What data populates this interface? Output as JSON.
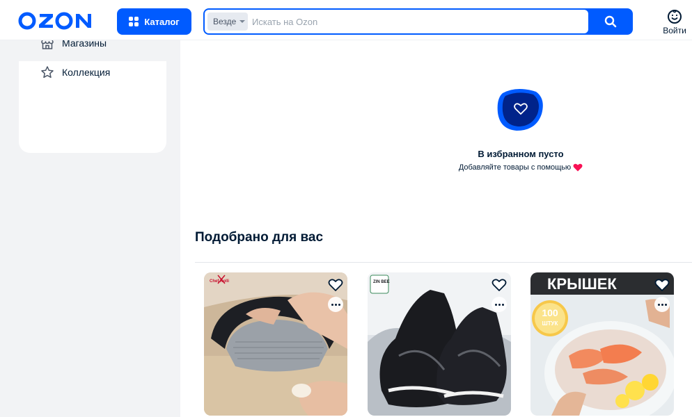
{
  "header": {
    "logo": "OZON",
    "catalog_label": "Каталог",
    "search_scope": "Везде",
    "search_placeholder": "Искать на Ozon",
    "login_label": "Войти"
  },
  "sidebar": {
    "items": [
      {
        "label": "Магазины",
        "icon": "shop-icon"
      },
      {
        "label": "Коллекция",
        "icon": "star-icon"
      }
    ]
  },
  "favorites": {
    "empty_title": "В избранном пусто",
    "empty_subtitle": "Добавляйте товары с помощью"
  },
  "recommendations": {
    "title": "Подобрано для вас",
    "products": [
      {
        "image": "garlic-press-photo",
        "brand_mark": "Chef Kolli"
      },
      {
        "image": "black-sneakers-photo",
        "brand_mark": "ZIN BEE"
      },
      {
        "image": "plastic-covers-photo",
        "headline": "КРЫШЕК",
        "badge_number": "100",
        "badge_unit": "ШТУК"
      }
    ]
  },
  "colors": {
    "brand_blue": "#005bff",
    "dark_navy": "#001a34",
    "sidebar_bg": "#f2f3f5",
    "heart_red": "#f91155"
  }
}
